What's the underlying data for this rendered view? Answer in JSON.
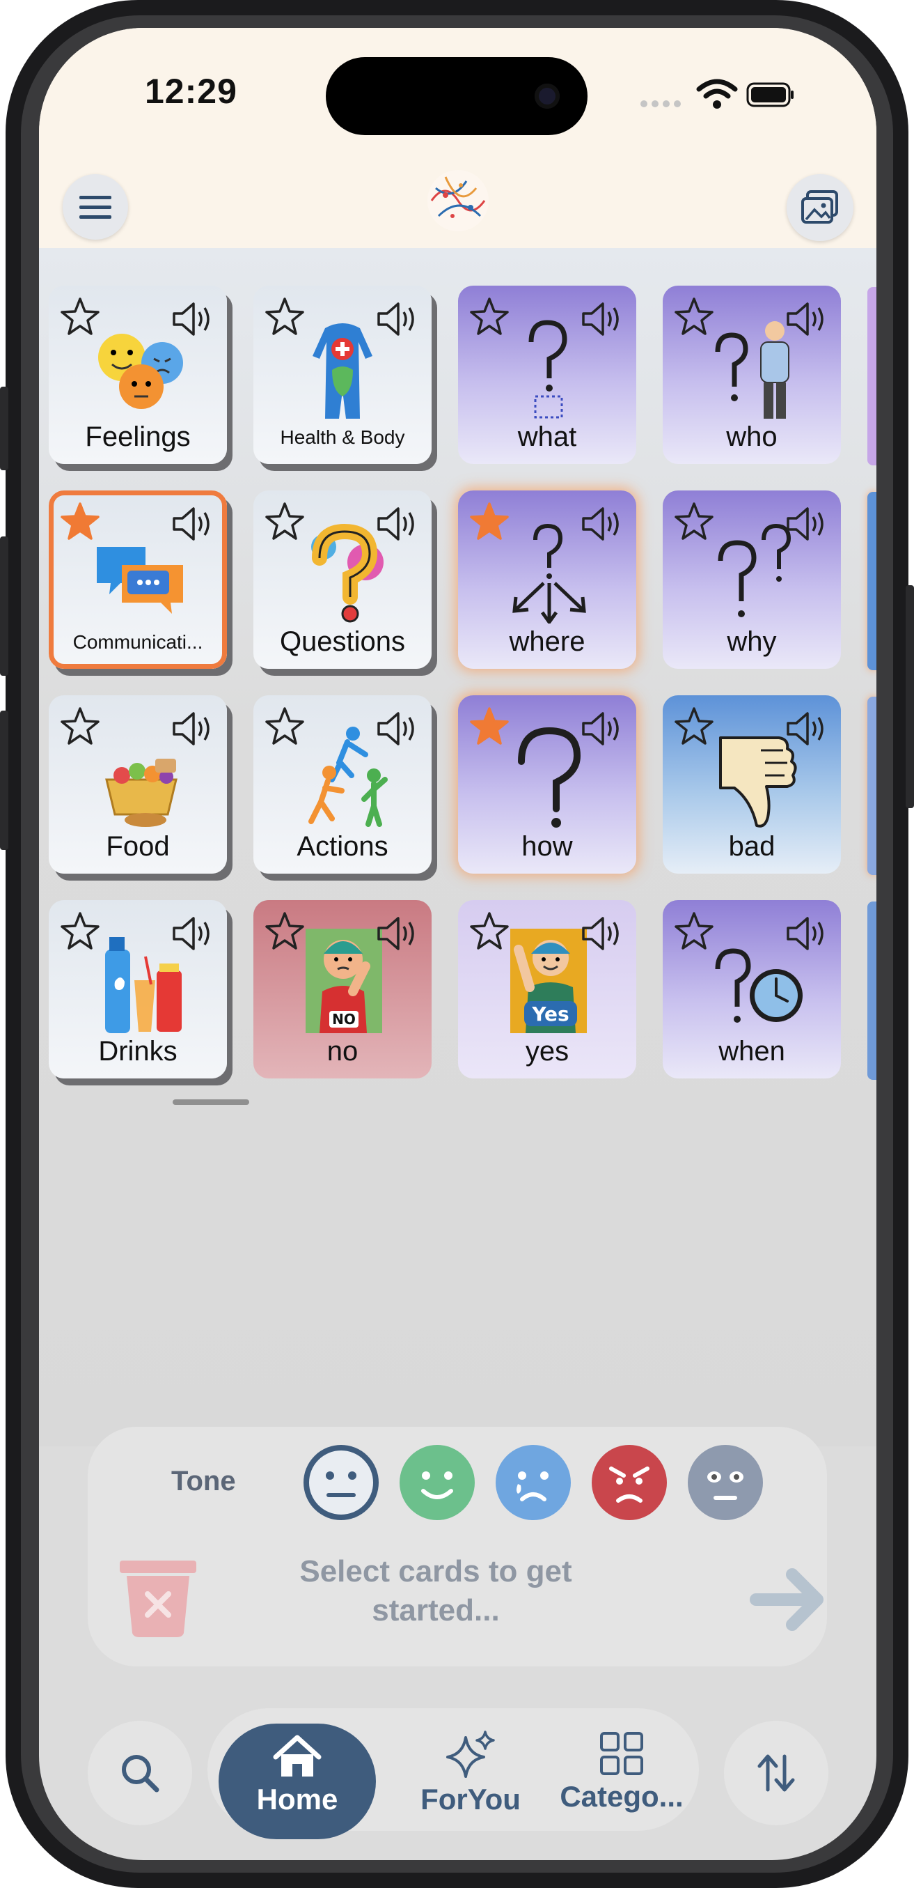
{
  "status_bar": {
    "time": "12:29"
  },
  "header": {
    "menu_icon": "hamburger-icon",
    "logo": "app-logo",
    "gallery_icon": "gallery-icon"
  },
  "cards": [
    {
      "label": "Feelings",
      "style": "gray",
      "starred": false,
      "icon": "feelings-faces"
    },
    {
      "label": "Health & Body",
      "style": "gray",
      "starred": false,
      "icon": "body-icon"
    },
    {
      "label": "what",
      "style": "purple",
      "starred": false,
      "icon": "question-square-icon"
    },
    {
      "label": "who",
      "style": "purple",
      "starred": false,
      "icon": "question-person-icon"
    },
    {
      "label": "Communicati...",
      "style": "gray",
      "starred": true,
      "selected": true,
      "icon": "chat-bubbles-icon"
    },
    {
      "label": "Questions",
      "style": "gray",
      "starred": false,
      "icon": "question-mark-icon"
    },
    {
      "label": "where",
      "style": "purple",
      "starred": true,
      "icon": "question-arrows-icon"
    },
    {
      "label": "why",
      "style": "purple",
      "starred": false,
      "icon": "double-question-icon"
    },
    {
      "label": "Food",
      "style": "gray",
      "starred": false,
      "icon": "food-basket-icon"
    },
    {
      "label": "Actions",
      "style": "gray",
      "starred": false,
      "icon": "actions-people-icon"
    },
    {
      "label": "how",
      "style": "purple",
      "starred": true,
      "icon": "big-question-icon"
    },
    {
      "label": "bad",
      "style": "blue",
      "starred": false,
      "icon": "thumbs-down-icon"
    },
    {
      "label": "Drinks",
      "style": "gray",
      "starred": false,
      "icon": "drinks-icon"
    },
    {
      "label": "no",
      "style": "red",
      "starred": false,
      "icon": "no-sign-icon"
    },
    {
      "label": "yes",
      "style": "lilac",
      "starred": false,
      "icon": "yes-sign-icon"
    },
    {
      "label": "when",
      "style": "purple",
      "starred": false,
      "icon": "question-clock-icon"
    }
  ],
  "composer": {
    "tone_label": "Tone",
    "tones": [
      {
        "name": "neutral-tone",
        "color": "#e9edf2",
        "selected": true
      },
      {
        "name": "happy-tone",
        "color": "#6cc08c"
      },
      {
        "name": "sad-tone",
        "color": "#6fa6e0"
      },
      {
        "name": "angry-tone",
        "color": "#c9464c"
      },
      {
        "name": "surprised-tone",
        "color": "#8e9aae"
      }
    ],
    "placeholder": "Select cards to get started...",
    "trash_icon": "trash-icon",
    "send_icon": "arrow-right-icon"
  },
  "nav": {
    "search_icon": "search-icon",
    "home": "Home",
    "foryou": "ForYou",
    "categories": "Catego...",
    "sort_icon": "sort-arrows-icon"
  },
  "colors": {
    "accent": "#3f5c7d",
    "highlight": "#ef7b3e"
  }
}
